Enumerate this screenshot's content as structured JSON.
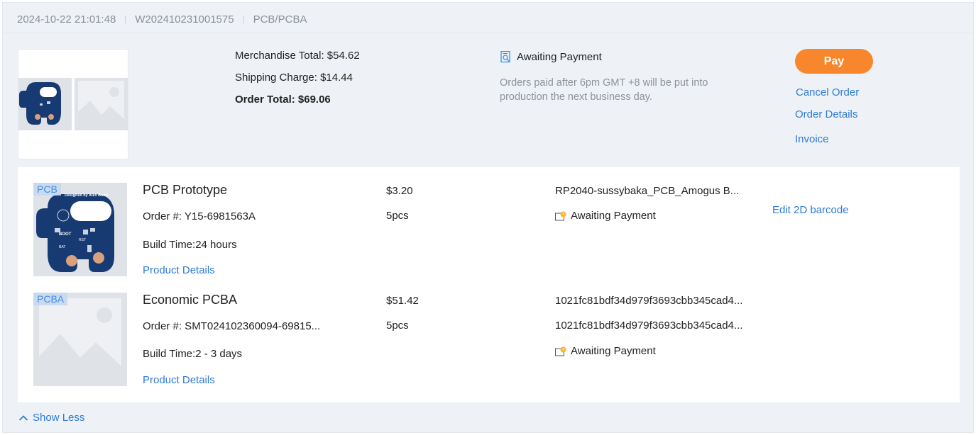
{
  "header": {
    "date": "2024-10-22 21:01:48",
    "order_no": "W202410231001575",
    "category": "PCB/PCBA"
  },
  "summary": {
    "merchandise": "Merchandise Total: $54.62",
    "shipping": "Shipping Charge: $14.44",
    "total": "Order Total: $69.06"
  },
  "status": {
    "label": "Awaiting Payment",
    "note": "Orders paid after 6pm GMT +8 will be put into production the next business day.",
    "icon": "document-search-icon"
  },
  "actions": {
    "pay": "Pay",
    "cancel": "Cancel Order",
    "details": "Order Details",
    "invoice": "Invoice"
  },
  "items": [
    {
      "tag": "PCB",
      "title": "PCB Prototype",
      "order": "Order #: Y15-6981563A",
      "build": "Build Time:24 hours",
      "details_link": "Product Details",
      "price": "$3.20",
      "qty": "5pcs",
      "file": "RP2040-sussybaka_PCB_Amogus B...",
      "status": "Awaiting Payment",
      "action": "Edit 2D barcode",
      "board_text": "Designed by Alex Bush",
      "board_labels": [
        "BOOT",
        "RST",
        "BAT"
      ]
    },
    {
      "tag": "PCBA",
      "title": "Economic PCBA",
      "order": "Order #: SMT024102360094-69815...",
      "build": "Build Time:2 - 3 days",
      "details_link": "Product Details",
      "price": "$51.42",
      "qty": "5pcs",
      "file1": "1021fc81bdf34d979f3693cbb345cad4...",
      "file2": "1021fc81bdf34d979f3693cbb345cad4...",
      "status": "Awaiting Payment"
    }
  ],
  "footer": {
    "show_less": "Show Less"
  },
  "colors": {
    "accent": "#2e7ad6",
    "pay": "#f7862c",
    "board": "#173a72",
    "copper": "#d8a07c"
  }
}
